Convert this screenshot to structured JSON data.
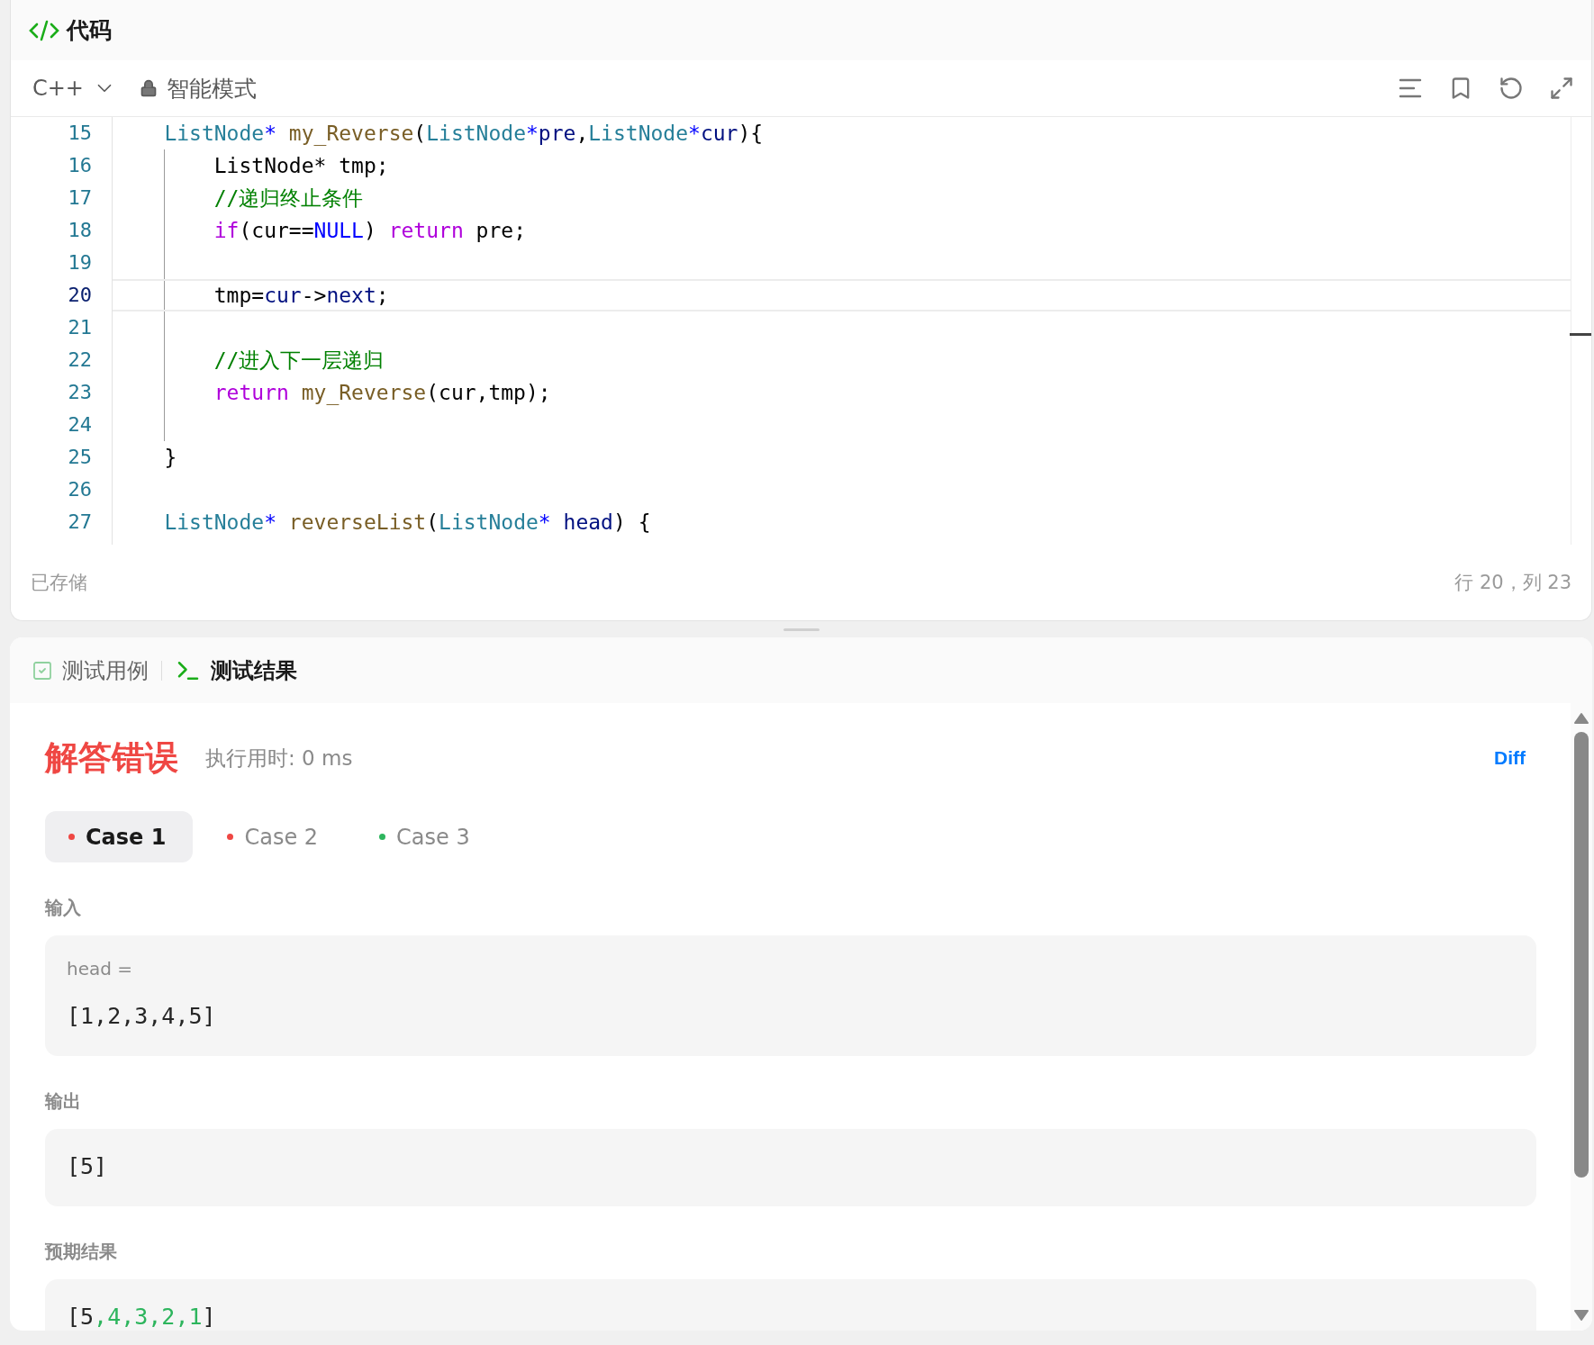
{
  "editor": {
    "title": "代码",
    "language": "C++",
    "mode": "智能模式",
    "lines": [
      {
        "number": "15",
        "selected": false,
        "guide": false,
        "tokens": [
          {
            "kind": "type",
            "text": "ListNode"
          },
          {
            "kind": "op",
            "text": "*"
          },
          {
            "kind": "func",
            "text": " my_Reverse"
          },
          {
            "kind": "plain",
            "text": "("
          },
          {
            "kind": "type",
            "text": "ListNode"
          },
          {
            "kind": "op",
            "text": "*"
          },
          {
            "kind": "var",
            "text": "pre"
          },
          {
            "kind": "plain",
            "text": ","
          },
          {
            "kind": "type",
            "text": "ListNode"
          },
          {
            "kind": "op",
            "text": "*"
          },
          {
            "kind": "var",
            "text": "cur"
          },
          {
            "kind": "plain",
            "text": "){"
          }
        ]
      },
      {
        "number": "16",
        "selected": false,
        "guide": true,
        "tokens": [
          {
            "kind": "plain",
            "text": "ListNode* tmp;"
          }
        ]
      },
      {
        "number": "17",
        "selected": false,
        "guide": true,
        "tokens": [
          {
            "kind": "comment",
            "text": "//递归终止条件"
          }
        ]
      },
      {
        "number": "18",
        "selected": false,
        "guide": true,
        "tokens": [
          {
            "kind": "keyword",
            "text": "if"
          },
          {
            "kind": "plain",
            "text": "(cur=="
          },
          {
            "kind": "const",
            "text": "NULL"
          },
          {
            "kind": "plain",
            "text": ") "
          },
          {
            "kind": "keyword",
            "text": "return"
          },
          {
            "kind": "plain",
            "text": " pre;"
          }
        ]
      },
      {
        "number": "19",
        "selected": false,
        "guide": true
      },
      {
        "number": "20",
        "selected": true,
        "guide": true,
        "tokens": [
          {
            "kind": "plain",
            "text": "tmp="
          },
          {
            "kind": "var",
            "text": "cur"
          },
          {
            "kind": "plain",
            "text": "->"
          },
          {
            "kind": "var",
            "text": "next"
          },
          {
            "kind": "plain",
            "text": ";"
          }
        ]
      },
      {
        "number": "21",
        "selected": false,
        "guide": true
      },
      {
        "number": "22",
        "selected": false,
        "guide": true,
        "tokens": [
          {
            "kind": "comment",
            "text": "//进入下一层递归"
          }
        ]
      },
      {
        "number": "23",
        "selected": false,
        "guide": true,
        "tokens": [
          {
            "kind": "keyword",
            "text": "return"
          },
          {
            "kind": "func",
            "text": " my_Reverse"
          },
          {
            "kind": "plain",
            "text": "(cur,tmp);"
          }
        ]
      },
      {
        "number": "24",
        "selected": false,
        "guide": true
      },
      {
        "number": "25",
        "selected": false,
        "guide": false,
        "tokens": [
          {
            "kind": "plain",
            "text": "}"
          }
        ]
      },
      {
        "number": "26",
        "selected": false,
        "guide": false
      },
      {
        "number": "27",
        "selected": false,
        "guide": false,
        "tokens": [
          {
            "kind": "type",
            "text": "ListNode"
          },
          {
            "kind": "op",
            "text": "*"
          },
          {
            "kind": "func",
            "text": " reverseList"
          },
          {
            "kind": "plain",
            "text": "("
          },
          {
            "kind": "type",
            "text": "ListNode"
          },
          {
            "kind": "op",
            "text": "*"
          },
          {
            "kind": "var",
            "text": " head"
          },
          {
            "kind": "plain",
            "text": ") {"
          }
        ]
      }
    ],
    "status_bar": {
      "saved": "已存储",
      "position": "行 20，列 23"
    }
  },
  "console": {
    "tabs": [
      {
        "label": "测试用例",
        "kind": "testcase",
        "selected": false
      },
      {
        "label": "测试结果",
        "kind": "terminal",
        "selected": true
      }
    ],
    "result": {
      "status": "解答错误",
      "runtime": "执行用时: 0 ms",
      "diff": "Diff"
    },
    "cases": [
      {
        "label": "Case 1",
        "selected": true,
        "color": "#ef4743"
      },
      {
        "label": "Case 2",
        "selected": false,
        "color": "#ef4743"
      },
      {
        "label": "Case 3",
        "selected": false,
        "color": "#2db55d"
      }
    ],
    "sections": [
      {
        "label": "输入",
        "name": "head =",
        "value": [
          {
            "text": "[1,2,3,4,5]",
            "diff": false
          }
        ]
      },
      {
        "label": "输出",
        "value": [
          {
            "text": "[5]",
            "diff": false
          }
        ]
      },
      {
        "label": "预期结果",
        "value": [
          {
            "text": "[5",
            "diff": false
          },
          {
            "text": ",4,3,2,1",
            "diff": true
          },
          {
            "text": "]",
            "diff": false
          }
        ]
      }
    ]
  }
}
